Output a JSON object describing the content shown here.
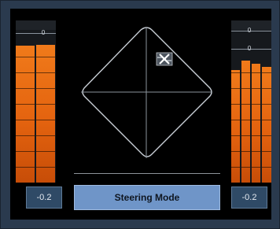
{
  "left_meter": {
    "scale_label": "0",
    "readout": "-0.2",
    "channel_levels": [
      0.86,
      0.87
    ]
  },
  "right_meter": {
    "scale_label_top": "0",
    "scale_label_bottom": "0",
    "readout": "-0.2",
    "channel_levels": [
      0.75,
      0.8,
      0.78,
      0.76
    ]
  },
  "panner": {
    "icon": "speaker-marker-icon"
  },
  "steering_mode": {
    "label": "Steering Mode"
  },
  "colors": {
    "meter_fill": "#e4630f",
    "button_bg": "#6f95c8",
    "panel_bg": "#2a3a4e"
  }
}
